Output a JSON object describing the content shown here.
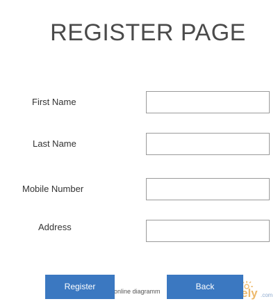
{
  "header": {
    "title": "REGISTER PAGE"
  },
  "form": {
    "first_name": {
      "label": "First Name",
      "value": ""
    },
    "last_name": {
      "label": "Last Name",
      "value": ""
    },
    "mobile_number": {
      "label": "Mobile Number",
      "value": ""
    },
    "address": {
      "label": "Address",
      "value": ""
    }
  },
  "buttons": {
    "register_label": "Register",
    "back_label": "Back"
  },
  "watermark": {
    "text": "online diagramm",
    "logo_text": "ely",
    "logo_domain": ".com"
  },
  "colors": {
    "button_bg": "#3b78c1",
    "title": "#4a4a4a"
  }
}
